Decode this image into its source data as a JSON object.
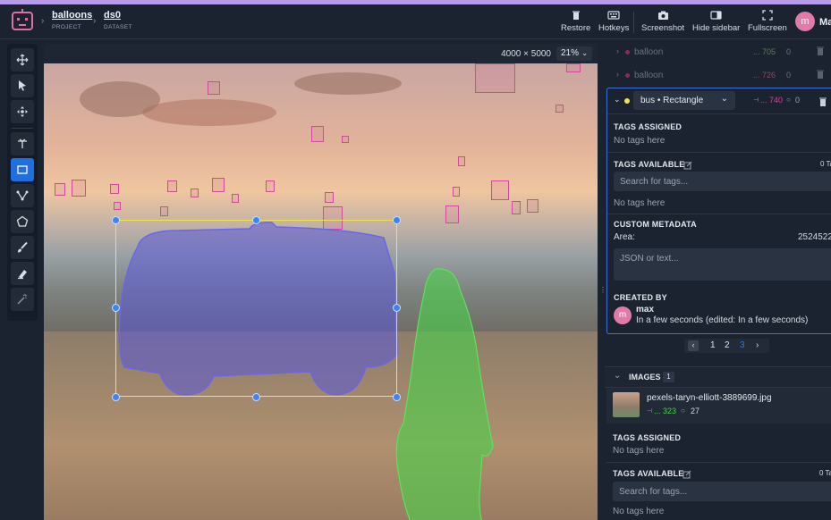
{
  "header": {
    "project_name": "balloons",
    "project_caption": "PROJECT",
    "dataset_name": "ds0",
    "dataset_caption": "DATASET",
    "buttons": {
      "restore": "Restore",
      "hotkeys": "Hotkeys",
      "screenshot": "Screenshot",
      "hide_sidebar": "Hide sidebar",
      "fullscreen": "Fullscreen"
    },
    "user_initial": "m",
    "user_name_partial": "Ma"
  },
  "tools": [
    "move-tool",
    "pointer-tool",
    "drag-tool",
    "point-tool",
    "rectangle-tool",
    "polyline-tool",
    "polygon-tool",
    "brush-tool",
    "eraser-tool",
    "magic-wand-tool"
  ],
  "canvas": {
    "image_size": "4000 × 5000",
    "zoom": "21%"
  },
  "objects": [
    {
      "label": "balloon",
      "stats": "... 705",
      "comments": "0"
    },
    {
      "label": "balloon",
      "stats": "... 726",
      "comments": "0"
    }
  ],
  "selected_object": {
    "class_label": "bus • Rectangle",
    "stats": "... 740",
    "comments": "0",
    "tags_assigned_title": "TAGS ASSIGNED",
    "tags_assigned_empty": "No tags here",
    "tags_available_title": "TAGS AVAILABLE",
    "tags_available_count": "0 Ta",
    "search_placeholder": "Search for tags...",
    "tags_available_empty": "No tags here",
    "custom_metadata_title": "CUSTOM METADATA",
    "area_label": "Area:",
    "area_value": "2524522",
    "json_placeholder": "JSON or text...",
    "created_by_title": "CREATED BY",
    "creator_initial": "m",
    "creator_name": "max",
    "created_time": "In a few seconds (edited: In a few seconds)"
  },
  "pagination": {
    "pages": [
      "1",
      "2",
      "3"
    ],
    "current": "3"
  },
  "images_section": {
    "title": "IMAGES",
    "count": "1",
    "filename": "pexels-taryn-elliott-3889699.jpg",
    "objects_count": "... 323",
    "comments_count": "27",
    "tags_assigned_title": "TAGS ASSIGNED",
    "tags_assigned_empty": "No tags here",
    "tags_available_title": "TAGS AVAILABLE",
    "tags_available_count": "0 Ta",
    "search_placeholder": "Search for tags...",
    "tags_available_empty": "No tags here"
  },
  "colors": {
    "accent_blue": "#1f6fe0",
    "balloon_box": "#d04a9c",
    "bus_mask": "#5a57d8",
    "person_mask": "#4bd14a",
    "selection": "#f1e34a",
    "highlight_border": "#3a73d8"
  }
}
